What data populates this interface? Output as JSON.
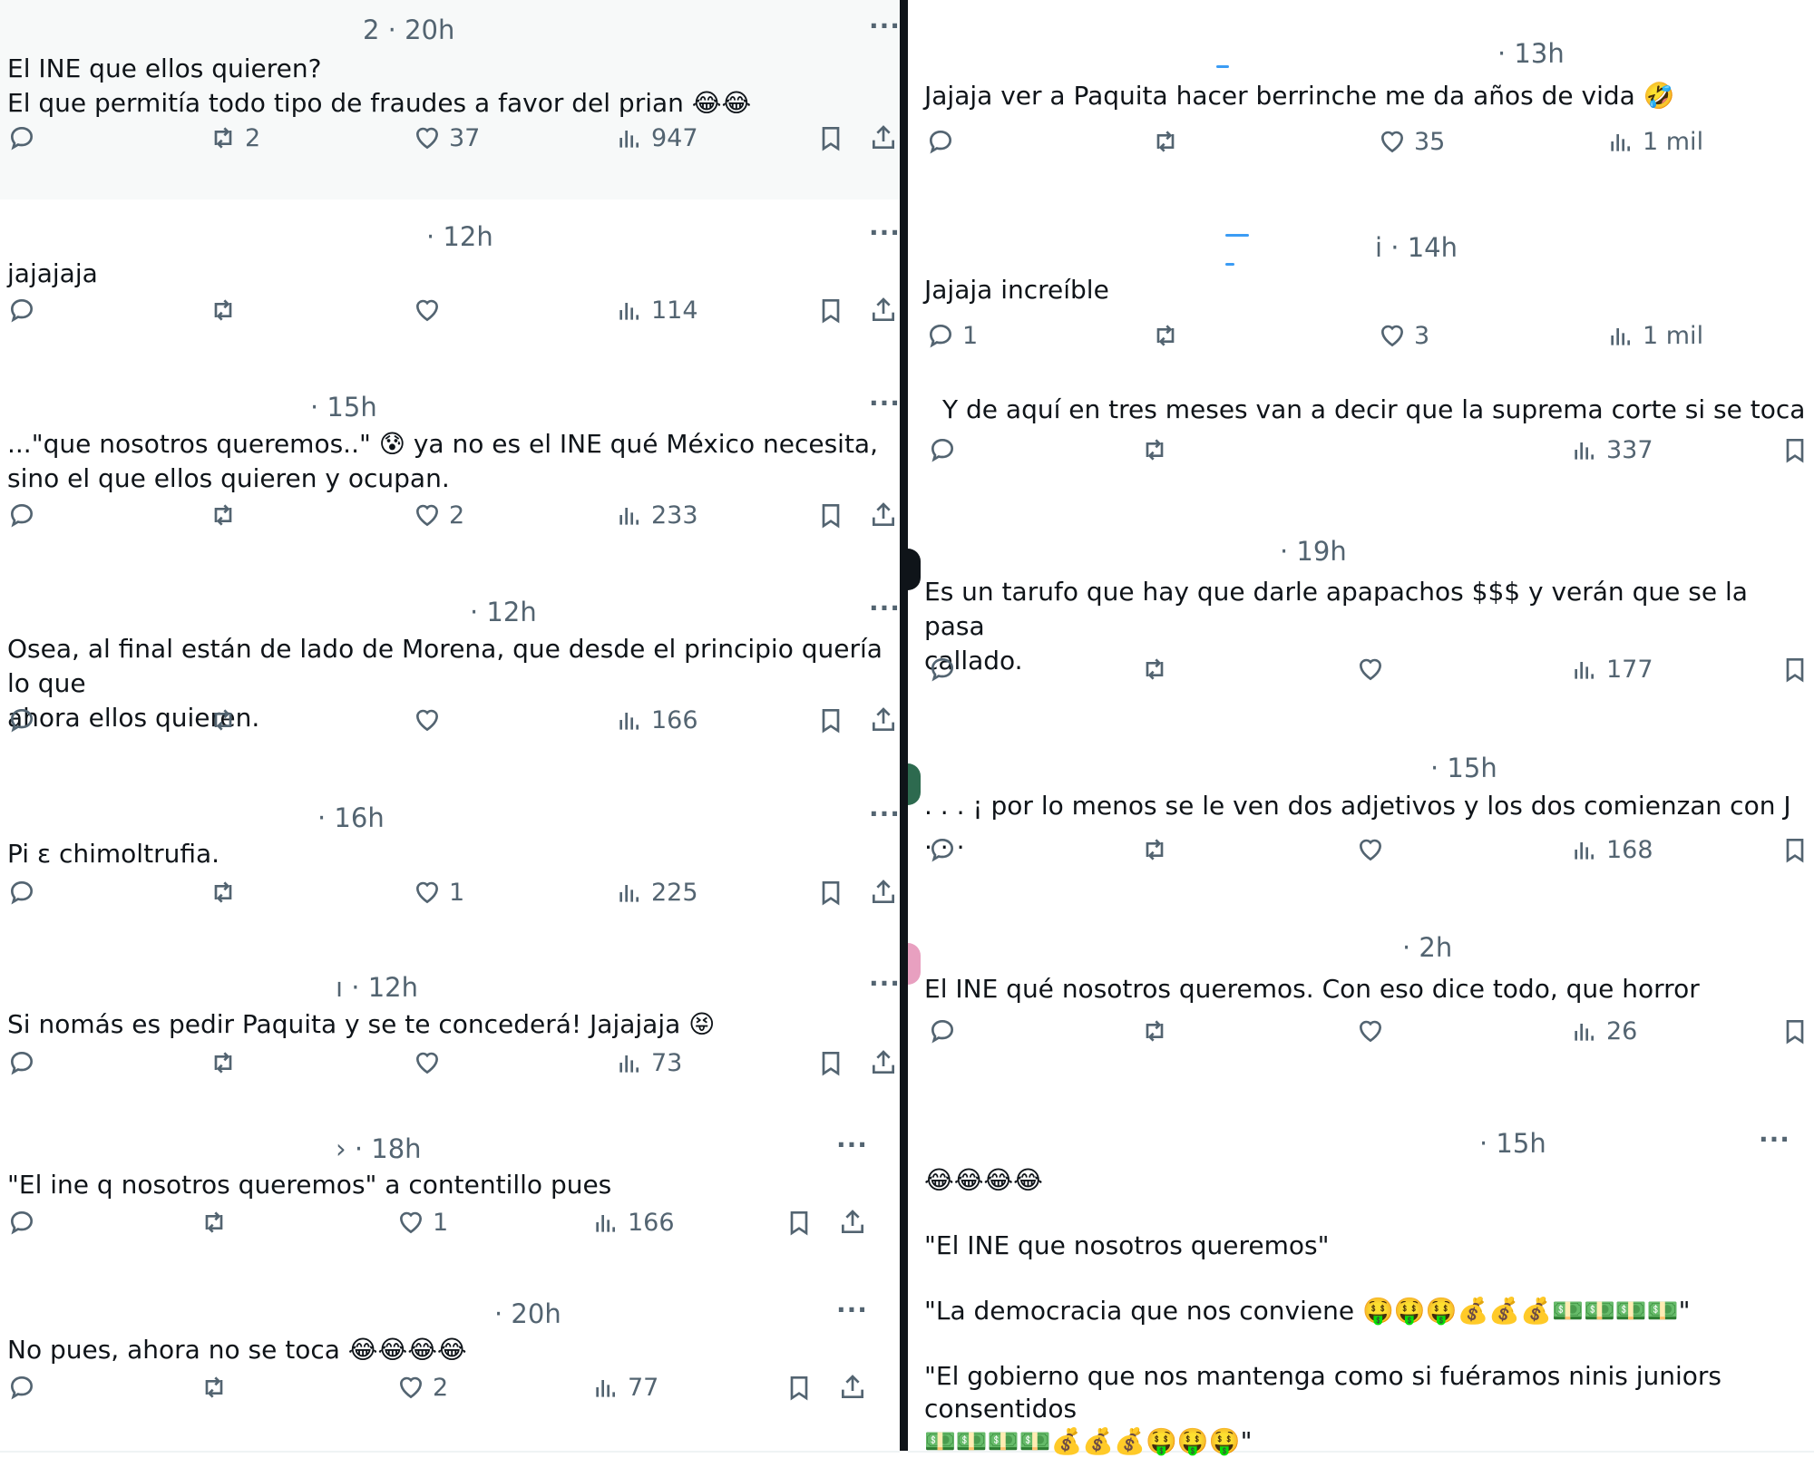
{
  "left_column": [
    {
      "time": "2 · 20h",
      "text": "El INE que ellos quieren?\nEl que permitía todo tipo de fraudes a favor del prian 😂😂",
      "replies": "",
      "retweets": "2",
      "likes": "37",
      "views": "947"
    },
    {
      "time": "· 12h",
      "text": "jajajaja",
      "replies": "",
      "retweets": "",
      "likes": "",
      "views": "114"
    },
    {
      "time": "· 15h",
      "text": "...\"que nosotros queremos..\"     😰 ya no es el INE qué México necesita,\nsino el que ellos quieren y ocupan.",
      "replies": "",
      "retweets": "",
      "likes": "2",
      "views": "233"
    },
    {
      "time": "· 12h",
      "text": "Osea, al final están de lado de Morena, que desde el principio quería lo que\nahora ellos quieren.",
      "replies": "",
      "retweets": "",
      "likes": "",
      "views": "166"
    },
    {
      "time": "· 16h",
      "text": "Pi      ɛ chimoltrufia.",
      "replies": "",
      "retweets": "",
      "likes": "1",
      "views": "225"
    },
    {
      "time": "ı · 12h",
      "text": "Si nomás es pedir Paquita y se te concederá! Jajajaja 😝",
      "replies": "",
      "retweets": "",
      "likes": "",
      "views": "73"
    },
    {
      "time": "› · 18h",
      "text": "\"El ine q nosotros queremos\" a contentillo pues",
      "replies": "",
      "retweets": "",
      "likes": "1",
      "views": "166"
    },
    {
      "time": "· 20h",
      "text": "No pues, ahora no se toca 😂😂😂😂",
      "replies": "",
      "retweets": "",
      "likes": "2",
      "views": "77"
    }
  ],
  "right_column": [
    {
      "time": "· 13h",
      "text": "Jajaja ver a Paquita hacer berrinche me da años de vida 🤣",
      "replies": "",
      "retweets": "",
      "likes": "35",
      "views": "1 mil"
    },
    {
      "time": "i · 14h",
      "text": "Jajaja increíble",
      "replies": "1",
      "retweets": "",
      "likes": "3",
      "views": "1 mil"
    },
    {
      "time": "",
      "text": "Y de aquí en tres meses van a decir que la suprema corte si se toca",
      "replies": "",
      "retweets": "",
      "likes": "",
      "views": "337"
    },
    {
      "time": "· 19h",
      "text": "Es un tarufo  que hay que darle apapachos $$$ y verán que se la pasa\ncallado.",
      "replies": "",
      "retweets": "",
      "likes": "",
      "views": "177"
    },
    {
      "time": "· 15h",
      "text": ". . . ¡ por lo menos se le ven dos adjetivos y los dos comienzan con J . . .",
      "replies": "",
      "retweets": "",
      "likes": "",
      "views": "168"
    },
    {
      "time": "· 2h",
      "text": "El INE qué nosotros queremos. Con eso dice todo, que horror",
      "replies": "",
      "retweets": "",
      "likes": "",
      "views": "26"
    },
    {
      "time": "· 15h",
      "text": "😂😂😂😂\n\n\"El INE que nosotros queremos\"\n\n\"La democracia que nos conviene 🤑🤑🤑💰💰💰💵💵💵💵\"\n\n\"El gobierno que nos mantenga como si fuéramos ninis juniors consentidos\n💵💵💵💵💰💰💰🤑🤑🤑\"",
      "replies": "",
      "retweets": "",
      "likes": "",
      "views": ""
    }
  ],
  "icons": {
    "more": "more-icon",
    "reply": "reply-icon",
    "retweet": "retweet-icon",
    "like": "heart-icon",
    "views": "views-icon",
    "bookmark": "bookmark-icon",
    "share": "share-icon"
  },
  "colors": {
    "text": "#0f1419",
    "muted": "#536471",
    "divider": "#0f1419",
    "redaction": "#3b9cf4"
  }
}
